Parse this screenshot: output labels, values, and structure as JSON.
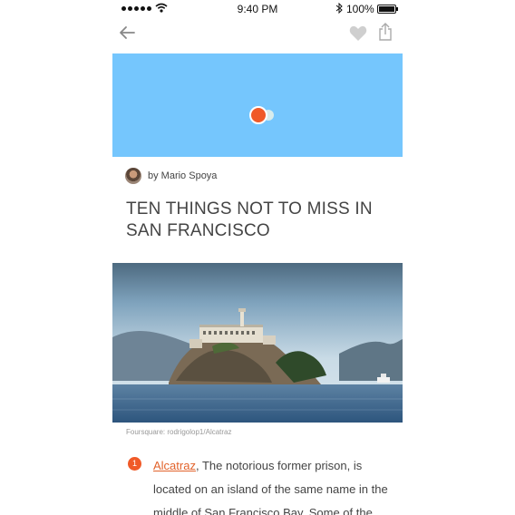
{
  "status_bar": {
    "time": "9:40 PM",
    "battery": "100%"
  },
  "icons": {
    "back": "back-arrow-icon",
    "favorite": "heart-icon",
    "share": "share-icon"
  },
  "author": {
    "byline": "by Mario Spoya"
  },
  "article": {
    "title": "TEN THINGS NOT TO MISS IN SAN FRANCISCO",
    "photo_caption": "Foursquare: rodrigolop1/Alcatraz"
  },
  "list_items": [
    {
      "number": "1",
      "link_text": "Alcatraz",
      "text": ", The notorious former prison, is located on an island of the same name in the middle of San Francisco Bay. Some of the"
    }
  ],
  "colors": {
    "map_background": "#75c6fd",
    "accent": "#f05a28"
  }
}
